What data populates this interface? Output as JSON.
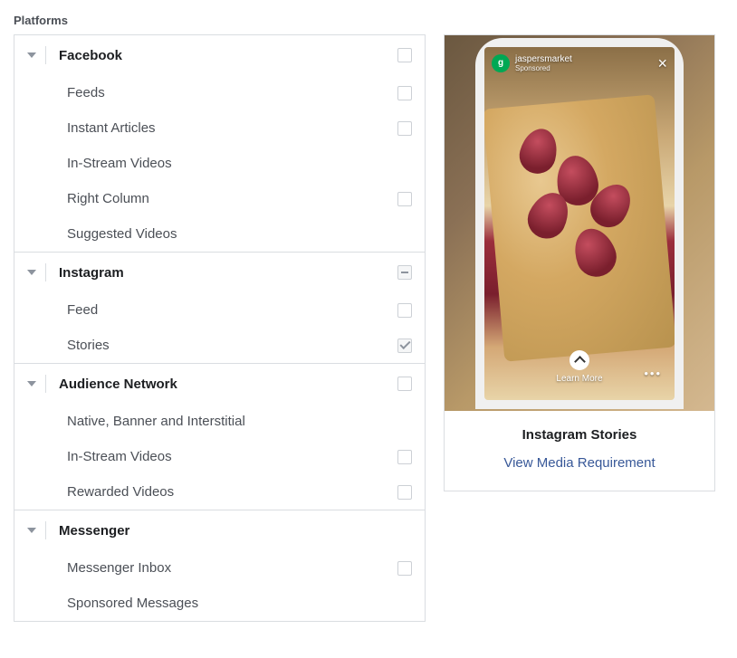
{
  "section_title": "Platforms",
  "platforms": [
    {
      "name": "Facebook",
      "state": "unchecked",
      "items": [
        {
          "label": "Feeds",
          "state": "unchecked"
        },
        {
          "label": "Instant Articles",
          "state": "unchecked"
        },
        {
          "label": "In-Stream Videos",
          "state": "none"
        },
        {
          "label": "Right Column",
          "state": "unchecked"
        },
        {
          "label": "Suggested Videos",
          "state": "none"
        }
      ]
    },
    {
      "name": "Instagram",
      "state": "indeterminate",
      "items": [
        {
          "label": "Feed",
          "state": "unchecked"
        },
        {
          "label": "Stories",
          "state": "checked"
        }
      ]
    },
    {
      "name": "Audience Network",
      "state": "unchecked",
      "items": [
        {
          "label": "Native, Banner and Interstitial",
          "state": "none"
        },
        {
          "label": "In-Stream Videos",
          "state": "unchecked"
        },
        {
          "label": "Rewarded Videos",
          "state": "unchecked"
        }
      ]
    },
    {
      "name": "Messenger",
      "state": "none",
      "items": [
        {
          "label": "Messenger Inbox",
          "state": "unchecked"
        },
        {
          "label": "Sponsored Messages",
          "state": "none"
        }
      ]
    }
  ],
  "preview": {
    "brand": "jaspersmarket",
    "sponsored_label": "Sponsored",
    "cta": "Learn More",
    "title": "Instagram Stories",
    "link_text": "View Media Requirement"
  }
}
